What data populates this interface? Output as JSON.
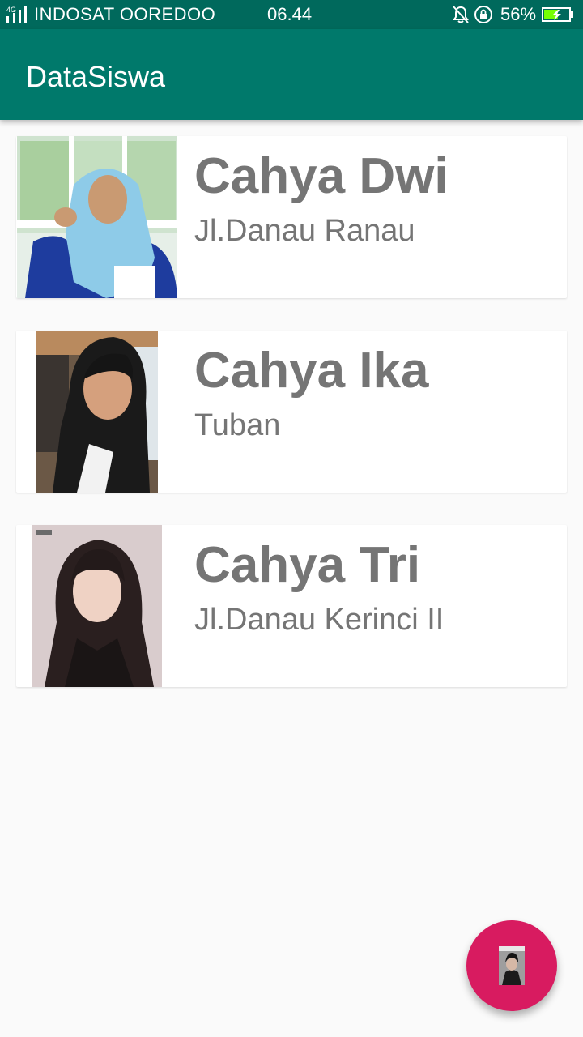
{
  "status_bar": {
    "network_type": "4G",
    "carrier": "INDOSAT OOREDOO",
    "time": "06.44",
    "battery_percent": "56%",
    "battery_level": 0.56,
    "charging": true,
    "icons": [
      "signal-icon",
      "bell-off-icon",
      "rotation-lock-icon",
      "battery-charging-icon"
    ]
  },
  "app_bar": {
    "title": "DataSiswa"
  },
  "students": [
    {
      "name": "Cahya Dwi",
      "address": "Jl.Danau Ranau"
    },
    {
      "name": "Cahya Ika",
      "address": "Tuban"
    },
    {
      "name": "Cahya Tri",
      "address": "Jl.Danau Kerinci II"
    }
  ],
  "fab": {
    "icon": "person-photo-icon"
  },
  "colors": {
    "primary": "#00796b",
    "primary_dark": "#00695c",
    "accent": "#d81b60",
    "text_secondary": "#757575",
    "background": "#fafafa"
  }
}
